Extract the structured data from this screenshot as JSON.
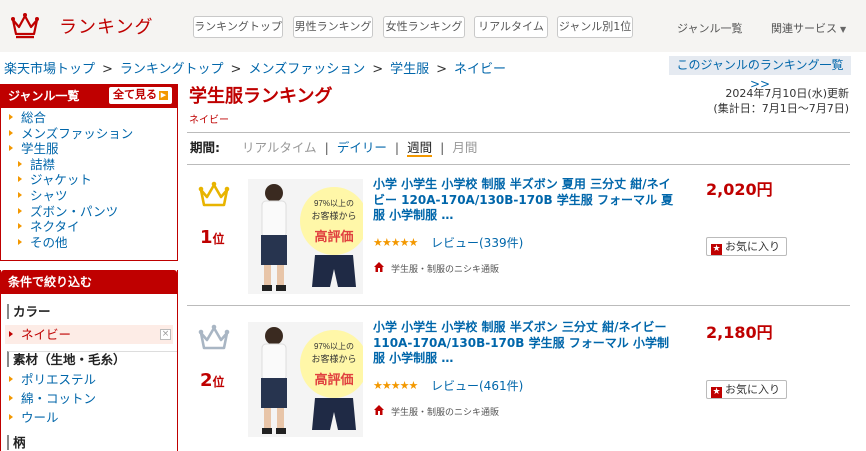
{
  "header": {
    "logo_text": "ランキング",
    "nav_buttons": [
      "ランキングトップ",
      "男性ランキング",
      "女性ランキング",
      "リアルタイム",
      "ジャンル別1位"
    ],
    "genre_list_link": "ジャンル一覧",
    "related_services": "関連サービス"
  },
  "breadcrumb": [
    "楽天市場トップ",
    "ランキングトップ",
    "メンズファッション",
    "学生服",
    "ネイビー"
  ],
  "genre_ranking_list_link": "このジャンルのランキング一覧 >>",
  "sidebar": {
    "genre_heading": "ジャンル一覧",
    "see_all": "全て見る",
    "genres": [
      {
        "label": "総合",
        "level": 0
      },
      {
        "label": "メンズファッション",
        "level": 0
      },
      {
        "label": "学生服",
        "level": 0
      },
      {
        "label": "詰襟",
        "level": 1
      },
      {
        "label": "ジャケット",
        "level": 1
      },
      {
        "label": "シャツ",
        "level": 1
      },
      {
        "label": "ズボン・パンツ",
        "level": 1
      },
      {
        "label": "ネクタイ",
        "level": 1
      },
      {
        "label": "その他",
        "level": 1
      }
    ],
    "filter_heading": "条件で絞り込む",
    "color_title": "カラー",
    "color_selected": "ネイビー",
    "clear_label": "×",
    "material_title": "素材（生地・毛糸）",
    "materials": [
      "ポリエステル",
      "綿・コットン",
      "ウール"
    ],
    "pattern_title": "柄"
  },
  "main": {
    "title": "学生服ランキング",
    "subtitle": "ネイビー",
    "updated_line1": "2024年7月10日(水)更新",
    "updated_line2": "(集計日：7月1日～7月7日)",
    "period_label": "期間:",
    "periods": [
      "リアルタイム",
      "デイリー",
      "週間",
      "月間"
    ]
  },
  "items": [
    {
      "rank": "1",
      "rank_suffix": "位",
      "title": "小学 小学生 小学校 制服 半ズボン 夏用 三分丈 紺/ネイビー 120A-170A/130B-170B 学生服 フォーマル 夏服 小学制服 …",
      "rating_stars": "★★★★★",
      "review": "レビュー(339件)",
      "shop": "学生服・制服のニシキ通販",
      "price": "2,020円",
      "fav_label": "お気に入り",
      "badge_line1": "97%以上の",
      "badge_line2": "お客様から",
      "badge_line3": "高評価",
      "crown_color": "#e8b400"
    },
    {
      "rank": "2",
      "rank_suffix": "位",
      "title": "小学 小学生 小学校 制服 半ズボン 三分丈 紺/ネイビー 110A-170A/130B-170B 学生服 フォーマル 小学制服 小学制服 …",
      "rating_stars": "★★★★★",
      "review": "レビュー(461件)",
      "shop": "学生服・制服のニシキ通販",
      "price": "2,180円",
      "fav_label": "お気に入り",
      "badge_line1": "97%以上の",
      "badge_line2": "お客様から",
      "badge_line3": "高評価",
      "crown_color": "#a9b6c4"
    }
  ],
  "colors": {
    "accent": "#bf0000",
    "link": "#0066aa",
    "orange": "#f39800"
  }
}
